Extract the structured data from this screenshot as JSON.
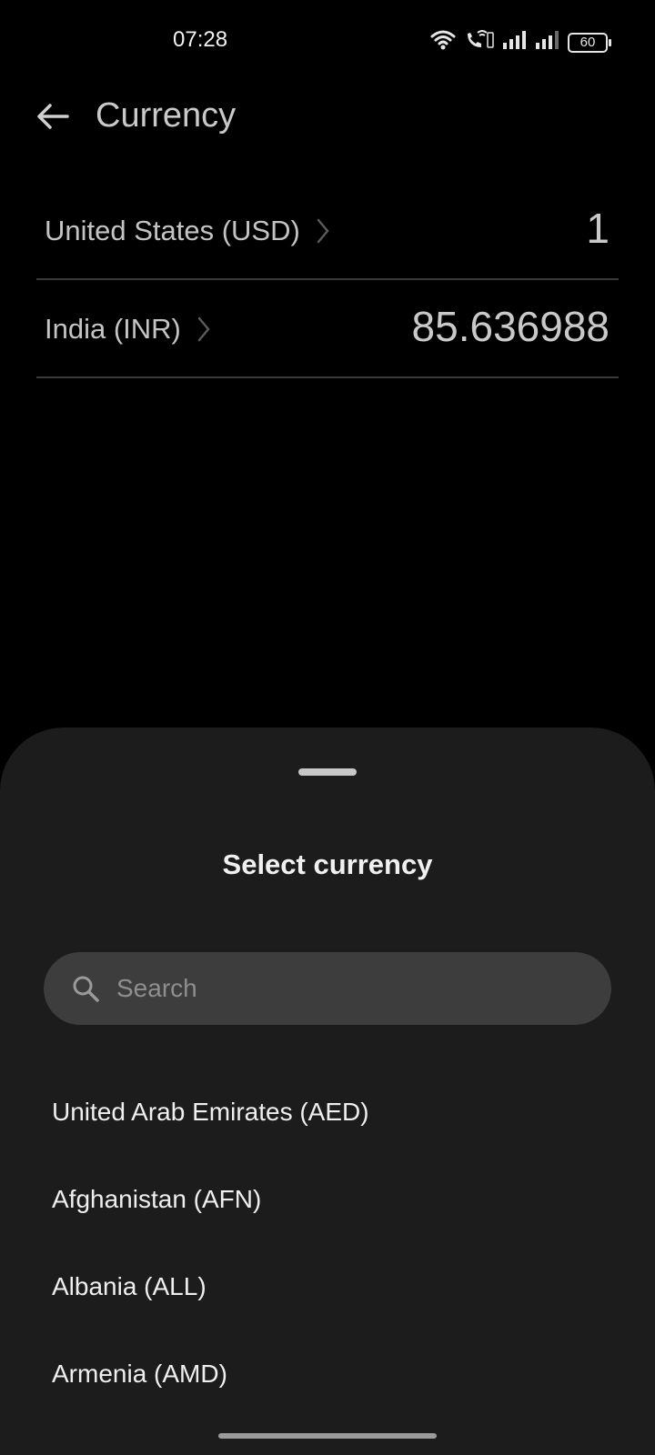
{
  "status_bar": {
    "time": "07:28",
    "battery_level": "60",
    "icons": [
      "wifi-icon",
      "vowifi-call-icon",
      "signal-sim1-icon",
      "signal-sim2-icon",
      "battery-icon"
    ]
  },
  "header": {
    "back_icon": "arrow-left-icon",
    "title": "Currency"
  },
  "converter": {
    "rows": [
      {
        "label": "United States (USD)",
        "value": "1"
      },
      {
        "label": "India (INR)",
        "value": "85.636988"
      }
    ]
  },
  "sheet": {
    "title": "Select currency",
    "search": {
      "placeholder": "Search",
      "value": ""
    },
    "currencies": [
      "United Arab Emirates (AED)",
      "Afghanistan (AFN)",
      "Albania (ALL)",
      "Armenia (AMD)"
    ]
  },
  "colors": {
    "background": "#000000",
    "sheet_background": "#1c1c1c",
    "search_background": "#3d3d3d",
    "divider": "#3a3a3a"
  }
}
